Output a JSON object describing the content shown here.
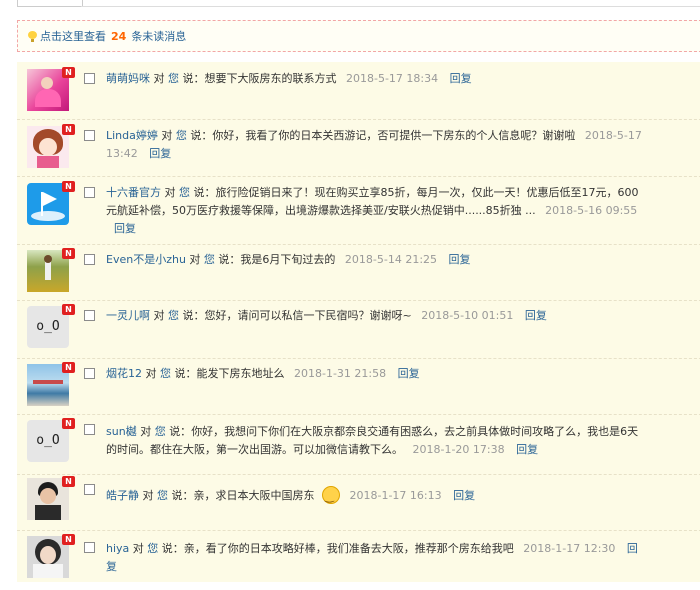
{
  "notice": {
    "prefix": "点击这里查看",
    "count": "24",
    "suffix": "条未读消息"
  },
  "common": {
    "dui": "对",
    "you": "您",
    "shuo": "说："
  },
  "colors": {
    "badge": "#e02020",
    "link": "#2a6496",
    "count": "#ff6600",
    "time": "#999999"
  },
  "messages": [
    {
      "user": "萌萌妈咪",
      "text": "想要下大阪房东的联系方式",
      "time": "2018-5-17 18:34",
      "reply": "回复",
      "badge": "N",
      "avatar": "avatar-pink-photo"
    },
    {
      "user": "Linda婷婷",
      "text": "你好，我看了你的日本关西游记，否可提供一下房东的个人信息呢？谢谢啦",
      "time": "2018-5-17 13:42",
      "reply": "回复",
      "badge": "N",
      "avatar": "avatar-cartoon-girl"
    },
    {
      "user": "十六番官方",
      "text": "旅行险促销日来了！现在购买立享85折，每月一次，仅此一天！优惠后低至17元，600元航延补偿，50万医疗救援等保障，出境游爆款选择美亚/安联火热促销中......85折独 ...",
      "time": "2018-5-16 09:55",
      "reply": "回复",
      "badge": "N",
      "avatar": "avatar-blue-flag"
    },
    {
      "user": "Even不是小zhu",
      "text": "我是6月下旬过去的",
      "time": "2018-5-14 21:25",
      "reply": "回复",
      "badge": "N",
      "avatar": "avatar-sunflower-field"
    },
    {
      "user": "一灵儿啊",
      "text": "您好，请问可以私信一下民宿吗？谢谢呀~",
      "time": "2018-5-10 01:51",
      "reply": "回复",
      "badge": "N",
      "avatar": "default-face",
      "face": "o_O"
    },
    {
      "user": "烟花12",
      "text": "能发下房东地址么",
      "time": "2018-1-31 21:58",
      "reply": "回复",
      "badge": "N",
      "avatar": "avatar-seaside"
    },
    {
      "user": "sun樾",
      "text": "你好，我想问下你们在大阪京都奈良交通有困惑么，去之前具体做时间攻略了么，我也是6天的时间。都住在大阪，第一次出国游。可以加微信请教下么。",
      "time": "2018-1-20 17:38",
      "reply": "回复",
      "badge": "N",
      "avatar": "default-face",
      "face": "o_O"
    },
    {
      "user": "皓子静",
      "text": "亲，求日本大阪中国房东",
      "time": "2018-1-17 16:13",
      "reply": "回复",
      "badge": "N",
      "avatar": "avatar-boy-photo",
      "emoji": "smile-emoji"
    },
    {
      "user": "hiya",
      "text": "亲，看了你的日本攻略好棒，我们准备去大阪，推荐那个房东给我吧",
      "time": "2018-1-17 12:30",
      "reply": "回复",
      "badge": "N",
      "avatar": "avatar-girl-photo"
    }
  ]
}
